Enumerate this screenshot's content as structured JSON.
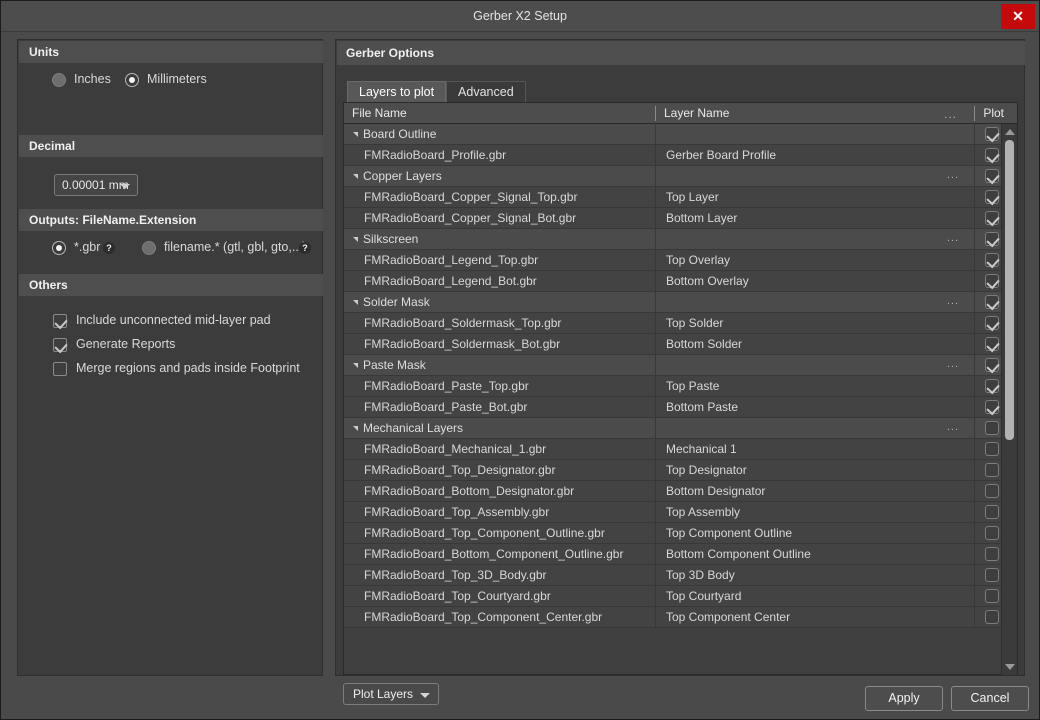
{
  "window": {
    "title": "Gerber X2 Setup",
    "close_label": "✕"
  },
  "left_panel": {
    "units": {
      "header": "Units",
      "options": [
        {
          "label": "Inches",
          "selected": false
        },
        {
          "label": "Millimeters",
          "selected": true
        }
      ]
    },
    "decimal": {
      "header": "Decimal",
      "value": "0.00001 mm"
    },
    "outputs": {
      "header": "Outputs: FileName.Extension",
      "options": [
        {
          "label": "*.gbr",
          "selected": true,
          "help": "?"
        },
        {
          "label": "filename.* (gtl, gbl, gto,...)",
          "selected": false,
          "help": "?"
        }
      ]
    },
    "others": {
      "header": "Others",
      "checkboxes": [
        {
          "label": "Include unconnected mid-layer pad",
          "checked": true
        },
        {
          "label": "Generate Reports",
          "checked": true
        },
        {
          "label": "Merge regions and pads inside Footprint",
          "checked": false
        }
      ]
    }
  },
  "right_panel": {
    "header": "Gerber Options",
    "tabs": [
      {
        "label": "Layers to plot",
        "active": true
      },
      {
        "label": "Advanced",
        "active": false
      }
    ],
    "table": {
      "columns": [
        "File Name",
        "Layer Name",
        "...",
        "Plot"
      ],
      "rows": [
        {
          "type": "group",
          "file": "Board Outline",
          "layer": "",
          "dots": false,
          "plot": true
        },
        {
          "type": "item",
          "file": "FMRadioBoard_Profile.gbr",
          "layer": "Gerber Board Profile",
          "dots": false,
          "plot": true
        },
        {
          "type": "group",
          "file": "Copper Layers",
          "layer": "",
          "dots": true,
          "plot": true
        },
        {
          "type": "item",
          "file": "FMRadioBoard_Copper_Signal_Top.gbr",
          "layer": "Top Layer",
          "dots": false,
          "plot": true
        },
        {
          "type": "item",
          "file": "FMRadioBoard_Copper_Signal_Bot.gbr",
          "layer": "Bottom Layer",
          "dots": false,
          "plot": true
        },
        {
          "type": "group",
          "file": "Silkscreen",
          "layer": "",
          "dots": true,
          "plot": true
        },
        {
          "type": "item",
          "file": "FMRadioBoard_Legend_Top.gbr",
          "layer": "Top Overlay",
          "dots": false,
          "plot": true
        },
        {
          "type": "item",
          "file": "FMRadioBoard_Legend_Bot.gbr",
          "layer": "Bottom Overlay",
          "dots": false,
          "plot": true
        },
        {
          "type": "group",
          "file": "Solder Mask",
          "layer": "",
          "dots": true,
          "plot": true
        },
        {
          "type": "item",
          "file": "FMRadioBoard_Soldermask_Top.gbr",
          "layer": "Top Solder",
          "dots": false,
          "plot": true
        },
        {
          "type": "item",
          "file": "FMRadioBoard_Soldermask_Bot.gbr",
          "layer": "Bottom Solder",
          "dots": false,
          "plot": true
        },
        {
          "type": "group",
          "file": "Paste Mask",
          "layer": "",
          "dots": true,
          "plot": true
        },
        {
          "type": "item",
          "file": "FMRadioBoard_Paste_Top.gbr",
          "layer": "Top Paste",
          "dots": false,
          "plot": true
        },
        {
          "type": "item",
          "file": "FMRadioBoard_Paste_Bot.gbr",
          "layer": "Bottom Paste",
          "dots": false,
          "plot": true
        },
        {
          "type": "group",
          "file": "Mechanical Layers",
          "layer": "",
          "dots": true,
          "plot": false
        },
        {
          "type": "item",
          "file": "FMRadioBoard_Mechanical_1.gbr",
          "layer": "Mechanical 1",
          "dots": false,
          "plot": false
        },
        {
          "type": "item",
          "file": "FMRadioBoard_Top_Designator.gbr",
          "layer": "Top Designator",
          "dots": false,
          "plot": false
        },
        {
          "type": "item",
          "file": "FMRadioBoard_Bottom_Designator.gbr",
          "layer": "Bottom Designator",
          "dots": false,
          "plot": false
        },
        {
          "type": "item",
          "file": "FMRadioBoard_Top_Assembly.gbr",
          "layer": "Top Assembly",
          "dots": false,
          "plot": false
        },
        {
          "type": "item",
          "file": "FMRadioBoard_Top_Component_Outline.gbr",
          "layer": "Top Component Outline",
          "dots": false,
          "plot": false
        },
        {
          "type": "item",
          "file": "FMRadioBoard_Bottom_Component_Outline.gbr",
          "layer": "Bottom Component Outline",
          "dots": false,
          "plot": false
        },
        {
          "type": "item",
          "file": "FMRadioBoard_Top_3D_Body.gbr",
          "layer": "Top 3D Body",
          "dots": false,
          "plot": false
        },
        {
          "type": "item",
          "file": "FMRadioBoard_Top_Courtyard.gbr",
          "layer": "Top Courtyard",
          "dots": false,
          "plot": false
        },
        {
          "type": "item",
          "file": "FMRadioBoard_Top_Component_Center.gbr",
          "layer": "Top Component Center",
          "dots": false,
          "plot": false
        }
      ]
    },
    "plot_layers_button": "Plot Layers"
  },
  "footer": {
    "apply_label": "Apply",
    "cancel_label": "Cancel"
  },
  "colors": {
    "close_red": "#c40a0a",
    "panel_bg": "#3c3c3c",
    "window_bg": "#4a4a4a",
    "header_bg": "#4e4e4e"
  }
}
